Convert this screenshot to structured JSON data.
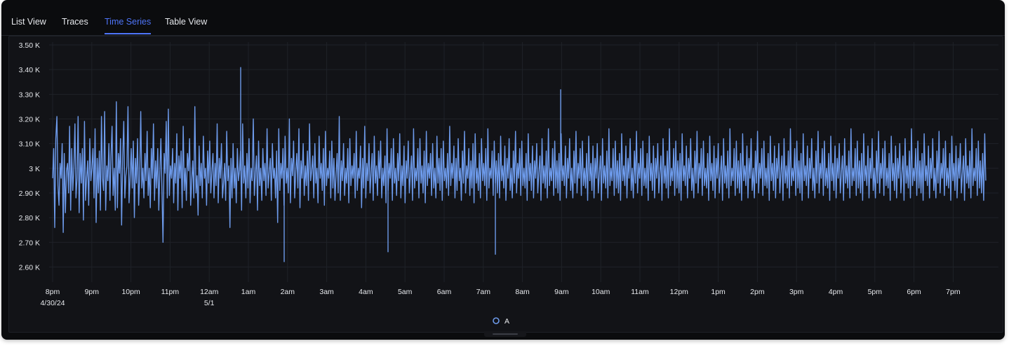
{
  "tabs": [
    {
      "label": "List View",
      "active": false
    },
    {
      "label": "Traces",
      "active": false
    },
    {
      "label": "Time Series",
      "active": true
    },
    {
      "label": "Table View",
      "active": false
    }
  ],
  "colors": {
    "accent": "#4e74f8",
    "series": "#6d9aea",
    "background": "#0b0c0e",
    "panel": "#121317"
  },
  "chart_data": {
    "type": "line",
    "grid": true,
    "legend_position": "bottom-center",
    "ylim": [
      2550,
      3500
    ],
    "y_ticks": [
      {
        "value": 3500,
        "label": "3.50 K"
      },
      {
        "value": 3400,
        "label": "3.40 K"
      },
      {
        "value": 3300,
        "label": "3.30 K"
      },
      {
        "value": 3200,
        "label": "3.20 K"
      },
      {
        "value": 3100,
        "label": "3.10 K"
      },
      {
        "value": 3000,
        "label": "3 K"
      },
      {
        "value": 2900,
        "label": "2.90 K"
      },
      {
        "value": 2800,
        "label": "2.80 K"
      },
      {
        "value": 2700,
        "label": "2.70 K"
      },
      {
        "value": 2600,
        "label": "2.60 K"
      }
    ],
    "x_start": "2024-04-30 20:00",
    "x_end": "2024-05-01 19:50",
    "x_ticks": [
      {
        "label": "8pm",
        "sub": "4/30/24"
      },
      {
        "label": "9pm",
        "sub": ""
      },
      {
        "label": "10pm",
        "sub": ""
      },
      {
        "label": "11pm",
        "sub": ""
      },
      {
        "label": "12am",
        "sub": "5/1"
      },
      {
        "label": "1am",
        "sub": ""
      },
      {
        "label": "2am",
        "sub": ""
      },
      {
        "label": "3am",
        "sub": ""
      },
      {
        "label": "4am",
        "sub": ""
      },
      {
        "label": "5am",
        "sub": ""
      },
      {
        "label": "6am",
        "sub": ""
      },
      {
        "label": "7am",
        "sub": ""
      },
      {
        "label": "8am",
        "sub": ""
      },
      {
        "label": "9am",
        "sub": ""
      },
      {
        "label": "10am",
        "sub": ""
      },
      {
        "label": "11am",
        "sub": ""
      },
      {
        "label": "12pm",
        "sub": ""
      },
      {
        "label": "1pm",
        "sub": ""
      },
      {
        "label": "2pm",
        "sub": ""
      },
      {
        "label": "3pm",
        "sub": ""
      },
      {
        "label": "4pm",
        "sub": ""
      },
      {
        "label": "5pm",
        "sub": ""
      },
      {
        "label": "6pm",
        "sub": ""
      },
      {
        "label": "7pm",
        "sub": ""
      }
    ],
    "series": [
      {
        "name": "A",
        "approximate": true,
        "interval_minutes": 2,
        "values": [
          2960,
          3080,
          2760,
          3120,
          3210,
          2930,
          2850,
          3020,
          2960,
          3100,
          2740,
          3060,
          2820,
          2990,
          3020,
          2900,
          3170,
          2830,
          3080,
          2910,
          3000,
          3180,
          2880,
          2960,
          3210,
          2820,
          3060,
          2940,
          3080,
          2790,
          3190,
          2870,
          2960,
          3030,
          2850,
          3120,
          2950,
          3000,
          3080,
          2880,
          3160,
          2780,
          3040,
          2900,
          3070,
          2830,
          3210,
          2960,
          2910,
          3230,
          2830,
          3010,
          2950,
          3100,
          2870,
          3050,
          3170,
          2890,
          3000,
          2830,
          3270,
          2840,
          3060,
          2980,
          3120,
          2770,
          3050,
          3190,
          2880,
          2970,
          3010,
          3250,
          2860,
          2960,
          3080,
          2920,
          3110,
          2800,
          3040,
          2940,
          3120,
          2850,
          2970,
          3230,
          2920,
          3000,
          2880,
          3060,
          2950,
          3150,
          2890,
          3000,
          2840,
          3080,
          2960,
          3180,
          2870,
          3030,
          2920,
          3080,
          2830,
          2990,
          3120,
          2910,
          2700,
          3060,
          2980,
          3190,
          2880,
          3240,
          2890,
          3010,
          2960,
          3080,
          2860,
          3020,
          2940,
          3140,
          2830,
          3050,
          2960,
          3070,
          2840,
          3170,
          2910,
          3000,
          2870,
          3060,
          2990,
          3120,
          2850,
          2950,
          3030,
          2880,
          3250,
          2900,
          2970,
          2810,
          3090,
          2930,
          3020,
          2880,
          3130,
          2960,
          3000,
          2850,
          3070,
          2940,
          3110,
          2900,
          2980,
          3060,
          2880,
          3020,
          2930,
          3180,
          2860,
          3040,
          2960,
          3100,
          2880,
          2940,
          3020,
          2870,
          3150,
          2950,
          3010,
          2760,
          3040,
          2880,
          3100,
          2920,
          3000,
          2860,
          3080,
          2950,
          2990,
          3070,
          2830,
          3180,
          2940,
          3010,
          2880,
          3060,
          2920,
          3120,
          2860,
          3000,
          2950,
          3200,
          2890,
          2980,
          3050,
          2830,
          3110,
          2930,
          3000,
          2870,
          3080,
          2950,
          3020,
          2890,
          3160,
          2920,
          2980,
          3040,
          2870,
          3100,
          2960,
          3000,
          2880,
          3070,
          2780,
          3160,
          2910,
          3020,
          2960,
          3080,
          2850,
          3130,
          2940,
          3000,
          2900,
          3200,
          2860,
          3040,
          2970,
          3110,
          2880,
          2990,
          3060,
          2920,
          3160,
          2840,
          3030,
          2960,
          3100,
          2890,
          3010,
          2930,
          3070,
          2870,
          3180,
          2950,
          2990,
          3050,
          2880,
          3100,
          2940,
          3000,
          2860,
          3130,
          2960,
          3020,
          2910,
          3080,
          2850,
          3150,
          2930,
          3000,
          2960,
          3070,
          2880,
          3110,
          2920,
          3040,
          2870,
          2980,
          3060,
          2900,
          3210,
          2870,
          3030,
          2950,
          3100,
          2890,
          3000,
          2940,
          3080,
          2860,
          3120,
          2930,
          3010,
          2960,
          3060,
          2880,
          3150,
          2910,
          3000,
          2960,
          3090,
          2840,
          3040,
          2920,
          3170,
          2880,
          3020,
          2950,
          3100,
          2900,
          2980,
          3060,
          2870,
          3130,
          2940,
          3010,
          2890,
          3070,
          2960,
          3110,
          2880,
          3000,
          2930,
          3050,
          2860,
          3160,
          2910,
          3020,
          2960,
          3080,
          2870,
          3120,
          2940,
          3000,
          2890,
          3060,
          2950,
          3140,
          2880,
          3010,
          2930,
          3090,
          2860,
          3030,
          2960,
          3110,
          2900,
          2980,
          3050,
          2870,
          3160,
          2920,
          3000,
          2950,
          3080,
          2880,
          3120,
          2940,
          3010,
          2900,
          3070,
          2860,
          3150,
          2930,
          3020,
          2960,
          3060,
          2890,
          3100,
          2920,
          3000,
          2880,
          3130,
          2940,
          3040,
          2910,
          3080,
          2870,
          3110,
          2950,
          3000,
          2920,
          3060,
          2890,
          3170,
          2930,
          3020,
          2960,
          3090,
          2880,
          3040,
          2910,
          3120,
          2950,
          3000,
          2870,
          3070,
          2940,
          3150,
          2900,
          3010,
          2960,
          3080,
          2890,
          3030,
          2920,
          3100,
          2860,
          3140,
          2940,
          3000,
          2910,
          3060,
          2880,
          3120,
          2950,
          3020,
          2930,
          3080,
          2870,
          3160,
          2920,
          3000,
          2960,
          3070,
          2890,
          3110,
          2940,
          3030,
          2900,
          3060,
          2880,
          3130,
          2950,
          3010,
          2920,
          3090,
          2870,
          3040,
          2960,
          3120,
          2910,
          3000,
          2880,
          3070,
          2940,
          3150,
          2900,
          3020,
          2960,
          3080,
          2890,
          3110,
          2930,
          3000,
          2920,
          3060,
          2870,
          3140,
          2950,
          3020,
          2910,
          3090,
          2880,
          3030,
          2960,
          3100,
          2900,
          2980,
          3050,
          2870,
          3120,
          2940,
          3010,
          2920,
          3070,
          2880,
          3160,
          2930,
          3000,
          2950,
          3080,
          2890,
          3110,
          2920,
          3030,
          2900,
          3060,
          2870,
          3140,
          2950,
          3010,
          2930,
          3090,
          2880,
          3040,
          2960,
          3120,
          2910,
          3000,
          2880,
          3070,
          2940,
          3150,
          2900,
          3020,
          2960,
          3080,
          2890,
          3110,
          2930,
          3000,
          2920,
          3060,
          2870,
          3130,
          2950,
          3020,
          2910,
          3090,
          2880,
          3040,
          2960,
          3100,
          2900,
          2980,
          3050,
          2870,
          3120,
          2940,
          3010,
          2920,
          3070,
          2880,
          3160,
          2930,
          3000,
          2950,
          3080,
          2890,
          3110,
          2920,
          3030,
          2900,
          3060,
          2870,
          3140,
          2950,
          3010,
          2930,
          3090,
          2880,
          3040,
          2960,
          3120,
          2910,
          3000,
          2880,
          3070,
          2940,
          3150,
          2900,
          3020,
          2960,
          3080,
          2890,
          3110,
          2930,
          3000,
          2920,
          3060,
          2870,
          3130,
          2950,
          3020,
          2910,
          3090,
          2880,
          3040,
          2960,
          3100,
          2900,
          2980,
          3050,
          2870,
          3120,
          2940,
          3010,
          2920,
          3070,
          2880,
          3160,
          2930,
          3000,
          2950,
          3080,
          2890,
          3110,
          2920,
          3030,
          2900,
          3060,
          2870,
          3140,
          2950,
          3010,
          2930,
          3090,
          2880,
          3040,
          2960,
          3120,
          2910,
          3000,
          2880,
          3070,
          2940,
          3150,
          2900,
          3020,
          2960,
          3080,
          2890,
          3110,
          2930,
          3000,
          2920,
          3060,
          2870,
          3130,
          2950,
          3020,
          2910,
          3090,
          2880,
          3040,
          2960,
          3100,
          2900,
          2980,
          3050,
          2870,
          3120,
          2940,
          3010,
          2920,
          3070,
          2880,
          3160,
          2930,
          3000,
          2950,
          3080,
          2890,
          3110,
          2920,
          3030,
          2900,
          3060,
          2870,
          3140,
          2950,
          3010,
          2930,
          3090,
          2880,
          3040,
          2960,
          3120,
          2910,
          3000,
          2880,
          3070,
          2940,
          3150,
          2900,
          3020,
          2960,
          3080,
          2890,
          3110,
          2930,
          3000,
          2920,
          3060,
          2870,
          3130,
          2950,
          3020,
          2910,
          3090,
          2880,
          3040,
          2960,
          3100,
          2900,
          2980,
          3050,
          2870,
          3120,
          2940,
          3010,
          2920,
          3070,
          2880,
          3160,
          2930,
          3000,
          2950,
          3080,
          2890,
          3110,
          2920,
          3030,
          2900,
          3060,
          2870,
          3140,
          2950,
          3010,
          2930,
          3090,
          2880,
          3040,
          2960,
          3120,
          2910,
          3000,
          2880,
          3070,
          2940,
          3150,
          2900,
          3020,
          2960,
          3080,
          2890,
          3110,
          2930,
          3000,
          2920,
          3060,
          2870,
          3130,
          2950,
          3020,
          2910,
          3090,
          2880,
          3040,
          2960,
          3100,
          2900,
          2980,
          3050,
          2870,
          3120,
          2940,
          3010,
          2920,
          3070,
          2880,
          3160,
          2930,
          3000,
          2950,
          3080,
          2890,
          3110,
          2920,
          3030,
          2900,
          3060,
          2870,
          3140,
          2950,
          3010,
          2930,
          3090,
          2880,
          3040,
          2960,
          3120,
          2910,
          3000,
          2880,
          3070,
          2940,
          3150,
          2900,
          3020,
          2960,
          3080,
          2890,
          3110,
          2930,
          3000,
          2920,
          3060,
          2870,
          3130,
          2950,
          3020,
          2910,
          3090,
          2880,
          3040,
          2960,
          3100,
          2900,
          2980,
          3050,
          2870,
          3120,
          2940,
          3010,
          2920,
          3070,
          2880,
          3160,
          2930,
          3000,
          2950,
          3080,
          2890,
          3110,
          2920,
          3030,
          2900,
          3060,
          2870,
          3140,
          2950,
          3010,
          2930,
          3090,
          2880,
          3040,
          2960,
          3120,
          2910,
          3000,
          2880,
          3070,
          2940,
          3150,
          2900,
          3020,
          2960,
          3080,
          2890,
          3110,
          2930,
          3000,
          2920,
          3060,
          2870,
          3130,
          2950,
          3020,
          2910,
          3090,
          2880,
          3040,
          2960,
          3100,
          2900,
          2980,
          3050,
          2870,
          3120,
          2940,
          3010,
          2920,
          3070,
          2880,
          3160,
          2930,
          3000,
          2950,
          3080,
          2890,
          3110,
          2920,
          3030,
          2900,
          3060,
          2870,
          3140,
          2950
        ]
      }
    ]
  }
}
